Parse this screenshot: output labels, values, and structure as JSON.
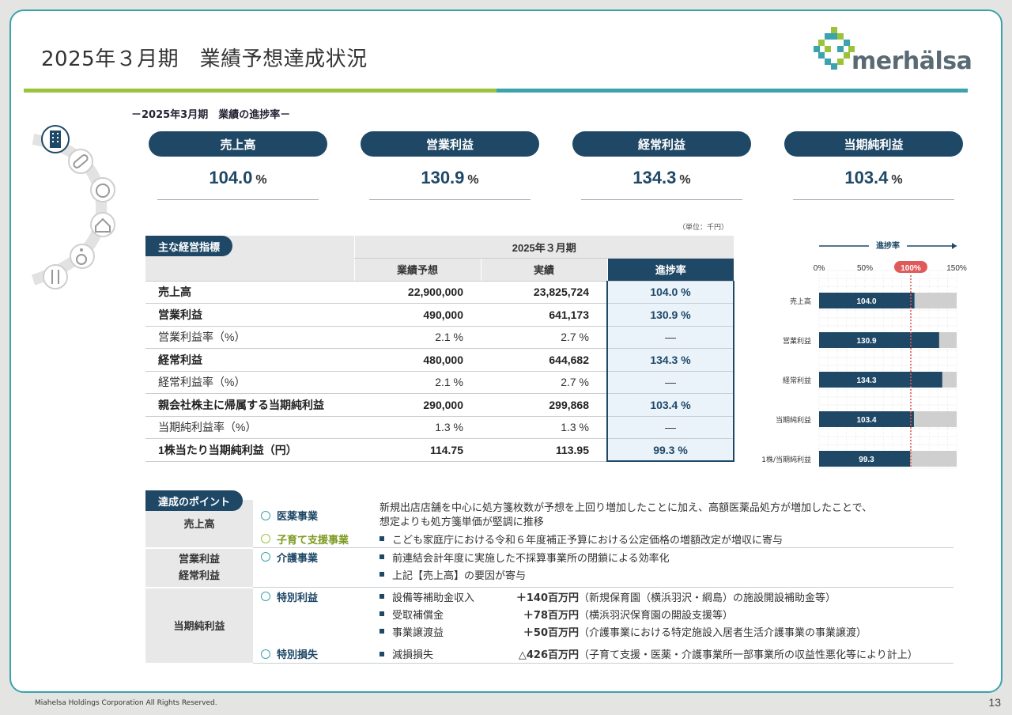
{
  "title": "2025年３月期　業績予想達成状況",
  "logo": {
    "text": "merhälsa"
  },
  "subheading": "－2025年3月期　業績の進捗率－",
  "kpis": [
    {
      "label": "売上高",
      "value": "104.0",
      "unit": "%"
    },
    {
      "label": "営業利益",
      "value": "130.9",
      "unit": "%"
    },
    {
      "label": "経常利益",
      "value": "134.3",
      "unit": "%"
    },
    {
      "label": "当期純利益",
      "value": "103.4",
      "unit": "%"
    }
  ],
  "indicators": {
    "tag": "主な経営指標",
    "unit_note": "（単位：千円）",
    "period_header": "2025年３月期",
    "col_forecast": "業績予想",
    "col_actual": "実績",
    "col_progress": "進捗率",
    "rows": [
      {
        "label": "売上高",
        "forecast": "22,900,000",
        "actual": "23,825,724",
        "progress": "104.0 %"
      },
      {
        "label": "営業利益",
        "forecast": "490,000",
        "actual": "641,173",
        "progress": "130.9 %"
      },
      {
        "label": "営業利益率（%）",
        "forecast": "2.1 %",
        "actual": "2.7 %",
        "progress": "―"
      },
      {
        "label": "経常利益",
        "forecast": "480,000",
        "actual": "644,682",
        "progress": "134.3 %"
      },
      {
        "label": "経常利益率（%）",
        "forecast": "2.1 %",
        "actual": "2.7 %",
        "progress": "―"
      },
      {
        "label": "親会社株主に帰属する当期純利益",
        "forecast": "290,000",
        "actual": "299,868",
        "progress": "103.4 %"
      },
      {
        "label": "当期純利益率（%）",
        "forecast": "1.3 %",
        "actual": "1.3 %",
        "progress": "―"
      },
      {
        "label": "1株当たり当期純利益（円）",
        "forecast": "114.75",
        "actual": "113.95",
        "progress": "99.3 %"
      }
    ]
  },
  "chart_data": {
    "type": "bar",
    "title": "進捗率",
    "categories": [
      "売上高",
      "営業利益",
      "経常利益",
      "当期純利益",
      "1株/当期純利益"
    ],
    "values": [
      104.0,
      130.9,
      134.3,
      103.4,
      99.3
    ],
    "value_labels": [
      "104.0",
      "130.9",
      "134.3",
      "103.4",
      "99.3"
    ],
    "xlim": [
      0,
      150
    ],
    "ticks": [
      "0%",
      "50%",
      "100%",
      "150%"
    ],
    "tick_values": [
      0,
      50,
      100,
      150
    ],
    "reference_line": 100,
    "colors": {
      "bar": "#1f4866",
      "track": "#cfcfcf",
      "reference": "#e05a5a"
    }
  },
  "points": {
    "tag": "達成のポイント",
    "groups": [
      {
        "category": "売上高",
        "rows": [
          {
            "segment": "医薬事業",
            "lines": [
              "新規出店店舗を中心に処方箋枚数が予想を上回り増加したことに加え、高額医薬品処方が増加したことで、",
              "想定よりも処方箋単価が堅調に推移"
            ],
            "bullet": false
          },
          {
            "segment": "子育て支援事業",
            "lines": [
              "こども家庭庁における令和６年度補正予算における公定価格の増額改定が増収に寄与"
            ],
            "bullet": true
          }
        ]
      },
      {
        "category": "営業利益\n経常利益",
        "category_lines": [
          "営業利益",
          "経常利益"
        ],
        "rows": [
          {
            "segment": "介護事業",
            "lines": [
              "前連結会計年度に実施した不採算事業所の閉鎖による効率化",
              "上記【売上高】の要因が寄与"
            ],
            "bullet": true
          }
        ]
      },
      {
        "category": "当期純利益",
        "rows": [
          {
            "segment": "特別利益",
            "items": [
              {
                "name": "設備等補助金収入",
                "amount": "＋140百万円",
                "note": "（新規保育園（横浜羽沢・綱島）の施設開設補助金等）"
              },
              {
                "name": "受取補償金",
                "amount": "＋78百万円",
                "note": "（横浜羽沢保育園の開設支援等）"
              },
              {
                "name": "事業譲渡益",
                "amount": "＋50百万円",
                "note": "（介護事業における特定施設入居者生活介護事業の事業譲渡）"
              }
            ]
          },
          {
            "segment": "特別損失",
            "items": [
              {
                "name": "減損損失",
                "amount": "△426百万円",
                "note": "（子育て支援・医薬・介護事業所一部事業所の収益性悪化等により計上）"
              }
            ]
          }
        ]
      }
    ]
  },
  "footer": "Miahelsa Holdings Corporation All Rights Reserved.",
  "page_number": "13"
}
